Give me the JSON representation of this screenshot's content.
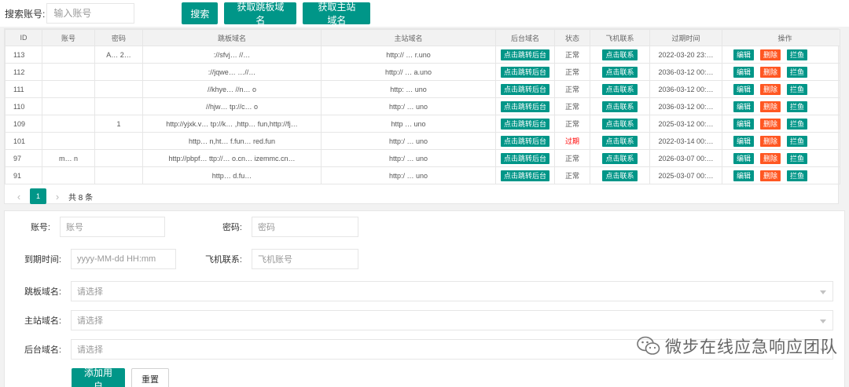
{
  "search": {
    "label": "搜索账号:",
    "placeholder": "输入账号",
    "search_btn": "搜索",
    "fetch_jump_btn": "获取跳板域名",
    "fetch_main_btn": "获取主站域名"
  },
  "table": {
    "headers": [
      "ID",
      "账号",
      "密码",
      "跳板域名",
      "主站域名",
      "后台域名",
      "状态",
      "飞机联系",
      "过期时间",
      "操作"
    ],
    "action_backend": "点击跳转后台",
    "action_contact": "点击联系",
    "op_edit": "编辑",
    "op_delete": "删除",
    "op_block": "拦鱼",
    "rows": [
      {
        "id": "113",
        "account": "",
        "password": "A… 2…",
        "jump": "://sfvj… //…",
        "main": "http:// … r.uno",
        "status": "正常",
        "expire": "2022-03-20 23:…"
      },
      {
        "id": "112",
        "account": "",
        "password": "",
        "jump": "://jqwe… …//…",
        "main": "http:// … a.uno",
        "status": "正常",
        "expire": "2036-03-12 00:…"
      },
      {
        "id": "111",
        "account": "",
        "password": "",
        "jump": "//khye… //n… o",
        "main": "http: … uno",
        "status": "正常",
        "expire": "2036-03-12 00:…"
      },
      {
        "id": "110",
        "account": "",
        "password": "",
        "jump": "//hjw… tp://c… o",
        "main": "http:/ … uno",
        "status": "正常",
        "expire": "2036-03-12 00:…"
      },
      {
        "id": "109",
        "account": "",
        "password": "1",
        "jump": "http://yjxk.v… tp://k… ,http… fun,http://fj…",
        "main": "http … uno",
        "status": "正常",
        "expire": "2025-03-12 00:…"
      },
      {
        "id": "101",
        "account": "",
        "password": "",
        "jump": "http… n,ht… f.fun… red.fun",
        "main": "http:/ … uno",
        "status": "过期",
        "expire": "2022-03-14 00:…"
      },
      {
        "id": "97",
        "account": "m… n",
        "password": "",
        "jump": "http://pbpf… ttp://… o.cn… izemmc.cn…",
        "main": "http:/ … uno",
        "status": "正常",
        "expire": "2026-03-07 00:…"
      },
      {
        "id": "91",
        "account": "",
        "password": "",
        "jump": "http… d.fu…",
        "main": "http:/ … uno",
        "status": "正常",
        "expire": "2025-03-07 00:…"
      }
    ]
  },
  "pager": {
    "current": "1",
    "total": "共 8 条"
  },
  "form": {
    "account_label": "账号:",
    "account_placeholder": "账号",
    "password_label": "密码:",
    "password_placeholder": "密码",
    "expire_label": "到期时间:",
    "expire_placeholder": "yyyy-MM-dd HH:mm",
    "contact_label": "飞机联系:",
    "contact_placeholder": "飞机账号",
    "jump_label": "跳板域名:",
    "main_label": "主站域名:",
    "backend_label": "后台域名:",
    "select_placeholder": "请选择",
    "add_btn": "添加用户",
    "reset_btn": "重置"
  },
  "watermark": {
    "text": "微步在线应急响应团队",
    "icon": "wechat-icon"
  },
  "colors": {
    "primary": "#009688",
    "danger": "#ff5722",
    "expired": "#ff0000"
  }
}
